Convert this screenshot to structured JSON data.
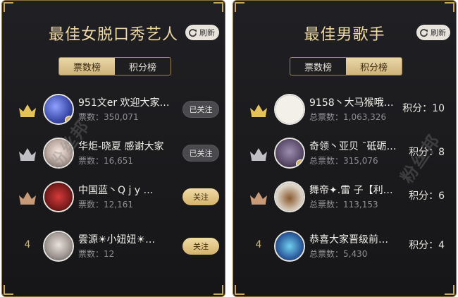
{
  "left_panel": {
    "title": "最佳女脱口秀艺人",
    "refresh_label": "刷新",
    "tabs": [
      {
        "label": "票数榜",
        "active": true
      },
      {
        "label": "积分榜",
        "active": false
      }
    ],
    "rows": [
      {
        "rank": "1",
        "rank_icon": "gold-crown-icon",
        "name": "951文er 欢迎大家…",
        "votes": "票数：350,071",
        "follow_label": "已关注",
        "followed": true,
        "avatar_color": "#3b4aa8"
      },
      {
        "rank": "2",
        "rank_icon": "silver-crown-icon",
        "name": "华炬-晓夏 感谢大家",
        "votes": "票数：16,651",
        "follow_label": "已关注",
        "followed": true,
        "avatar_color": "#c9c2bc"
      },
      {
        "rank": "3",
        "rank_icon": "bronze-crown-icon",
        "name": "中国蓝丶Q j y …",
        "votes": "票数：12,161",
        "follow_label": "关注",
        "followed": false,
        "avatar_color": "#7a1c1c"
      },
      {
        "rank": "4",
        "rank_icon": "",
        "name": "雲源☀小妞妞☀…",
        "votes": "票数：12",
        "follow_label": "关注",
        "followed": false,
        "avatar_color": "#8a8a8a"
      }
    ]
  },
  "right_panel": {
    "title": "最佳男歌手",
    "refresh_label": "刷新",
    "tabs": [
      {
        "label": "票数榜",
        "active": false
      },
      {
        "label": "积分榜",
        "active": true
      }
    ],
    "rows": [
      {
        "rank": "1",
        "rank_icon": "gold-crown-icon",
        "name": "9158丶大马猴哦…",
        "votes": "总票数：1,063,326",
        "score": "积分：10",
        "avatar_color": "#f3f0ea"
      },
      {
        "rank": "2",
        "rank_icon": "silver-crown-icon",
        "name": "奇领丶亚贝 ˉ砥砺…",
        "votes": "总票数：315,076",
        "score": "积分：8",
        "avatar_color": "#5b4b6a"
      },
      {
        "rank": "3",
        "rank_icon": "bronze-crown-icon",
        "name": "舞帝✦.雷 子【利…",
        "votes": "总票数：113,153",
        "score": "积分：6",
        "avatar_color": "#d9cfc2"
      },
      {
        "rank": "4",
        "rank_icon": "",
        "name": "恭喜大家晋级前…",
        "votes": "总票数：5,430",
        "score": "积分：4",
        "avatar_color": "#2d5e9e"
      }
    ]
  },
  "watermark_text": "粉丝邦",
  "colors": {
    "gold": "#e6c25a",
    "silver": "#bfbfc4",
    "bronze": "#c89a78",
    "panel_bg": "#1b1b1e",
    "accent": "#d4b26c"
  }
}
